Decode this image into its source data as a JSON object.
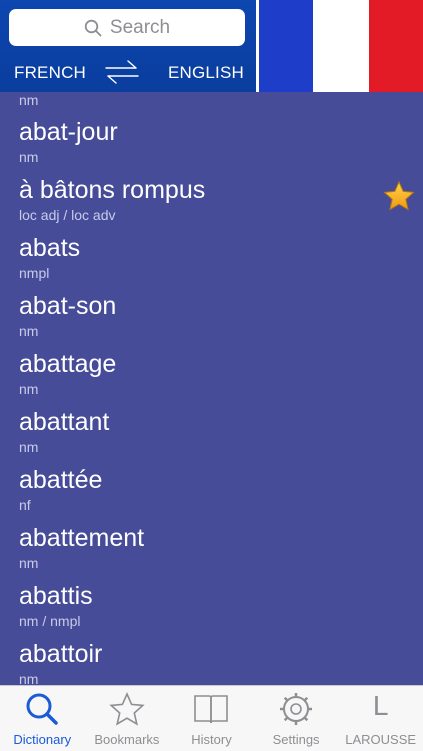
{
  "header": {
    "search_placeholder": "Search",
    "from_lang": "FRENCH",
    "to_lang": "ENGLISH"
  },
  "colors": {
    "header_blue": "#0a3d9e",
    "list_bg": "#474c99",
    "flag_blue": "#1e3ec9",
    "flag_red": "#e21b26",
    "active_tab": "#1a5bd6",
    "star": "#f5a623"
  },
  "list": {
    "first_pos": "nm",
    "entries": [
      {
        "word": "abat-jour",
        "pos": "nm",
        "bookmarked": false
      },
      {
        "word": "à bâtons rompus",
        "pos": "loc adj / loc adv",
        "bookmarked": true
      },
      {
        "word": "abats",
        "pos": "nmpl",
        "bookmarked": false
      },
      {
        "word": "abat-son",
        "pos": "nm",
        "bookmarked": false
      },
      {
        "word": "abattage",
        "pos": "nm",
        "bookmarked": false
      },
      {
        "word": "abattant",
        "pos": "nm",
        "bookmarked": false
      },
      {
        "word": "abattée",
        "pos": "nf",
        "bookmarked": false
      },
      {
        "word": "abattement",
        "pos": "nm",
        "bookmarked": false
      },
      {
        "word": "abattis",
        "pos": "nm / nmpl",
        "bookmarked": false
      },
      {
        "word": "abattoir",
        "pos": "nm",
        "bookmarked": false
      }
    ]
  },
  "tabs": [
    {
      "label": "Dictionary",
      "icon": "search-icon",
      "active": true
    },
    {
      "label": "Bookmarks",
      "icon": "star-icon",
      "active": false
    },
    {
      "label": "History",
      "icon": "book-icon",
      "active": false
    },
    {
      "label": "Settings",
      "icon": "gear-icon",
      "active": false
    },
    {
      "label": "LAROUSSE",
      "icon": "larousse-l-icon",
      "active": false
    }
  ],
  "tab_icon_letter": "L"
}
